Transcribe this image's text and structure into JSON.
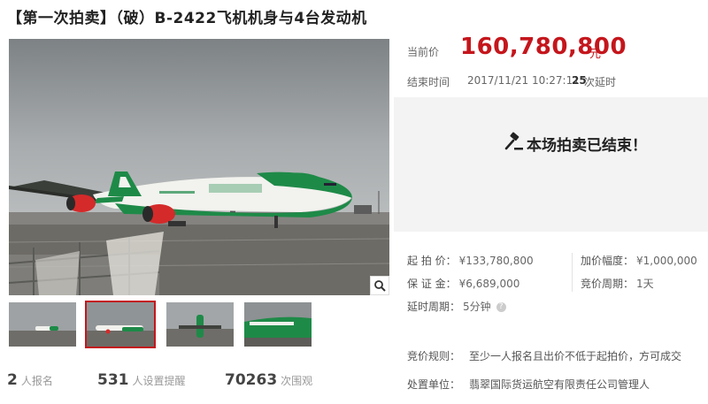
{
  "title": "【第一次拍卖】（破）B-2422飞机机身与4台发动机",
  "price": {
    "label": "当前价",
    "value": "160,780,800",
    "unit": "元"
  },
  "end": {
    "label": "结束时间",
    "time": "2017/11/21 10:27:11",
    "delay_count": "25",
    "delay_label": "次延时"
  },
  "status": {
    "ended_text": "本场拍卖已结束！"
  },
  "info": {
    "start_price_label": "起 拍 价：",
    "start_price": "¥133,780,800",
    "increment_label": "加价幅度：",
    "increment": "¥1,000,000",
    "deposit_label": "保 证 金：",
    "deposit": "¥6,689,000",
    "period_label": "竞价周期：",
    "period": "1天",
    "delay_period_label": "延时周期：",
    "delay_period": "5分钟",
    "help_icon": "?"
  },
  "rules": {
    "bid_rule_label": "竞价规则：",
    "bid_rule": "至少一人报名且出价不低于起拍价，方可成交",
    "disposal_label": "处置单位：",
    "disposal": "翡翠国际货运航空有限责任公司管理人"
  },
  "stats": [
    {
      "num": "2",
      "label": "人报名"
    },
    {
      "num": "531",
      "label": "人设置提醒"
    },
    {
      "num": "70263",
      "label": "次围观"
    }
  ],
  "icons": {
    "zoom": "magnifier-icon",
    "gavel": "gavel-icon"
  },
  "colors": {
    "price": "#c4161c",
    "plane_green": "#1e8a48",
    "engine_red": "#d42a2a",
    "active_border": "#c4161c"
  },
  "thumbnails_count": 4,
  "active_thumbnail": 2
}
